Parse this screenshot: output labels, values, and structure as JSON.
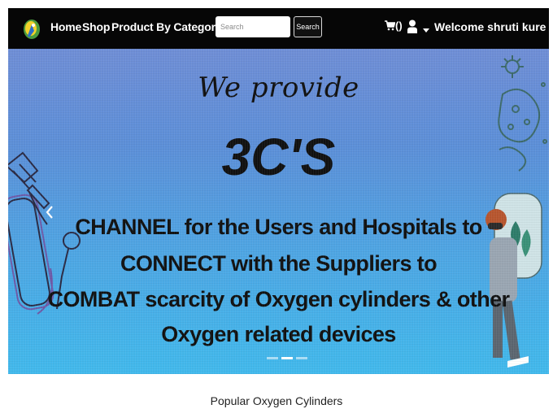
{
  "navbar": {
    "links": [
      "Home",
      "Shop",
      "Product By Category"
    ],
    "search": {
      "placeholder": "Search",
      "button_label": "Search"
    },
    "cart": {
      "label": "()"
    },
    "welcome": "Welcome shruti kure",
    "icons": [
      "brand-logo-icon",
      "cart-icon",
      "user-icon",
      "caret-down-icon"
    ]
  },
  "carousel": {
    "tagline": "We provide",
    "headline": "3C'S",
    "lines": [
      "CHANNEL for the Users and Hospitals to",
      "CONNECT with the Suppliers to",
      "COMBAT scarcity of Oxygen cylinders & other",
      "Oxygen related devices"
    ],
    "slide_count": 3,
    "active_slide": 2
  },
  "section": {
    "title": "Popular Oxygen Cylinders"
  },
  "colors": {
    "navbar": "#060606",
    "carousel_top": "#6f8ed6",
    "carousel_bottom": "#41b9ec",
    "text_dark": "#111111"
  }
}
